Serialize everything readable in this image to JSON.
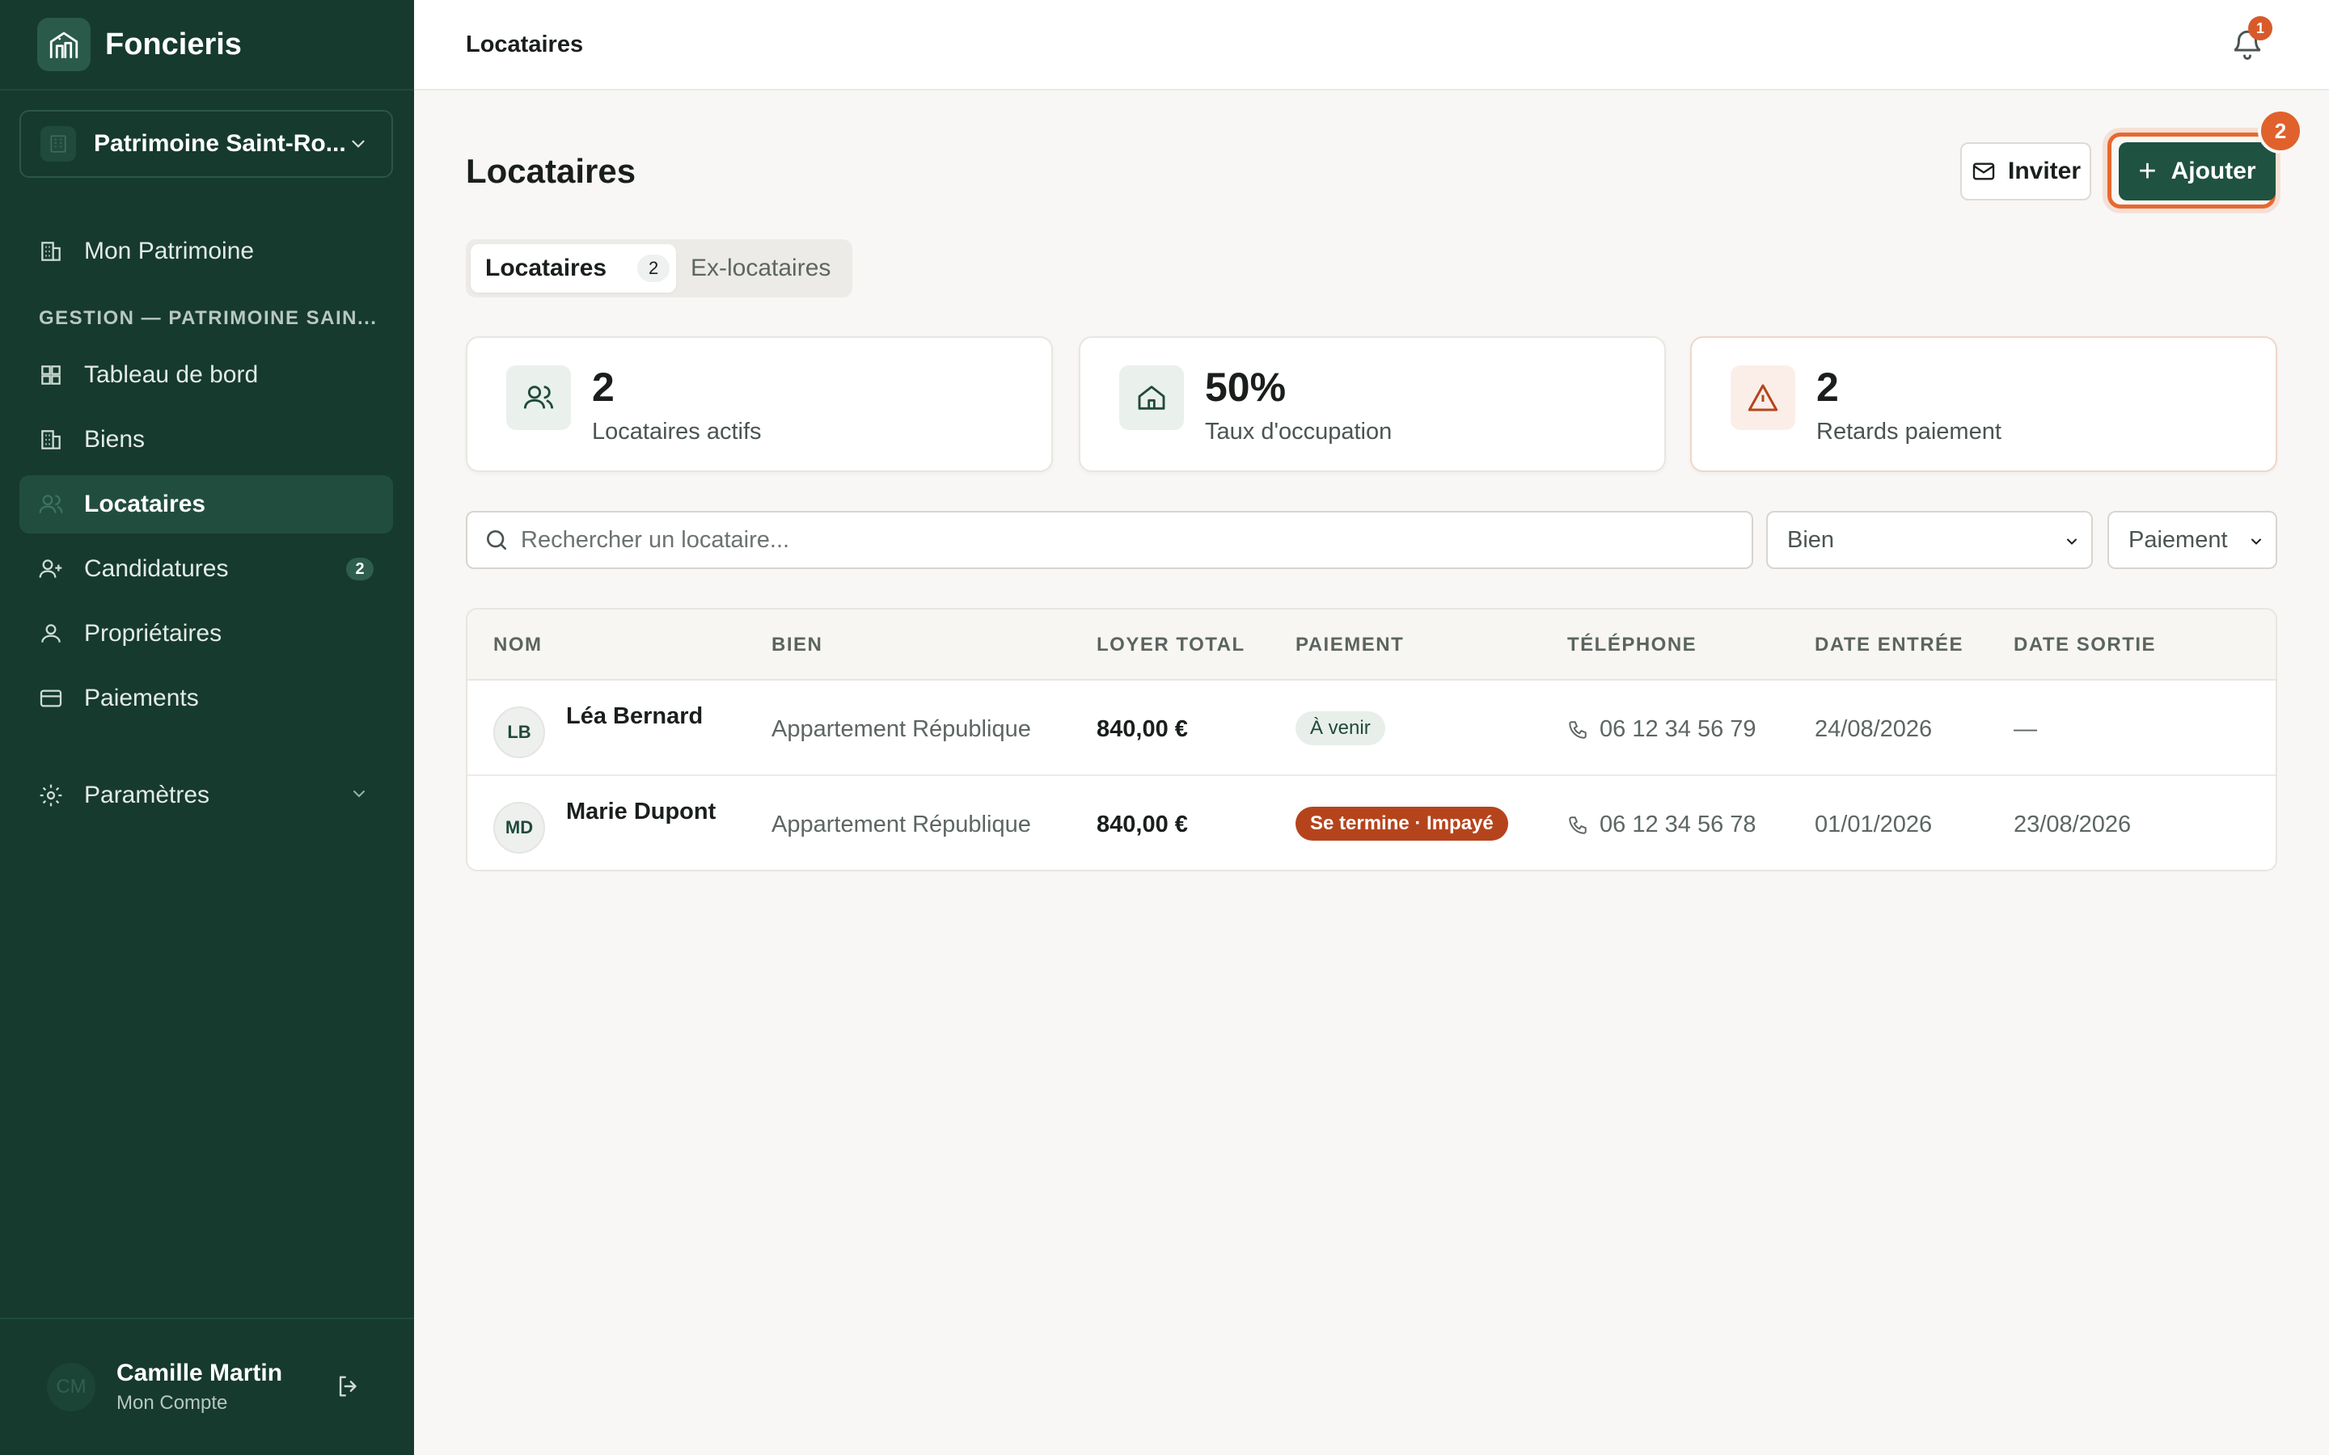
{
  "app": {
    "name": "Foncieris"
  },
  "sidebar": {
    "patrimoine_selector": "Patrimoine Saint-Ro...",
    "top_item": "Mon Patrimoine",
    "section_label": "GESTION — PATRIMOINE SAIN...",
    "items": [
      {
        "label": "Tableau de bord",
        "icon": "dashboard-icon"
      },
      {
        "label": "Biens",
        "icon": "building-icon"
      },
      {
        "label": "Locataires",
        "icon": "users-icon",
        "active": true
      },
      {
        "label": "Candidatures",
        "icon": "user-plus-icon",
        "count": "2"
      },
      {
        "label": "Propriétaires",
        "icon": "user-icon"
      },
      {
        "label": "Paiements",
        "icon": "credit-card-icon"
      }
    ],
    "settings": "Paramètres",
    "user": {
      "initials": "CM",
      "name": "Camille Martin",
      "subtitle": "Mon Compte"
    }
  },
  "topbar": {
    "title": "Locataires",
    "notification_count": "1"
  },
  "page": {
    "title": "Locataires",
    "invite_label": "Inviter",
    "add_label": "Ajouter",
    "step_badge": "2",
    "tabs": [
      {
        "label": "Locataires",
        "count": "2"
      },
      {
        "label": "Ex-locataires"
      }
    ],
    "stats": [
      {
        "value": "2",
        "label": "Locataires actifs"
      },
      {
        "value": "50%",
        "label": "Taux d'occupation"
      },
      {
        "value": "2",
        "label": "Retards paiement"
      }
    ],
    "search_placeholder": "Rechercher un locataire...",
    "filters": {
      "bien": "Bien",
      "paiement": "Paiement"
    }
  },
  "table": {
    "columns": [
      "NOM",
      "BIEN",
      "LOYER TOTAL",
      "PAIEMENT",
      "TÉLÉPHONE",
      "DATE ENTRÉE",
      "DATE SORTIE"
    ],
    "rows": [
      {
        "initials": "LB",
        "name": "Léa Bernard",
        "bien": "Appartement République",
        "loyer": "840,00 €",
        "paiement": "À venir",
        "telephone": "06 12 34 56 79",
        "date_entree": "24/08/2026",
        "date_sortie": "—"
      },
      {
        "initials": "MD",
        "name": "Marie Dupont",
        "bien": "Appartement République",
        "loyer": "840,00 €",
        "paiement": "Se termine · Impayé",
        "telephone": "06 12 34 56 78",
        "date_entree": "01/01/2026",
        "date_sortie": "23/08/2026"
      }
    ]
  },
  "colors": {
    "sidebar": "#163a2e",
    "accent": "#1f5240",
    "highlight": "#e7682f",
    "late": "#b5441c"
  }
}
